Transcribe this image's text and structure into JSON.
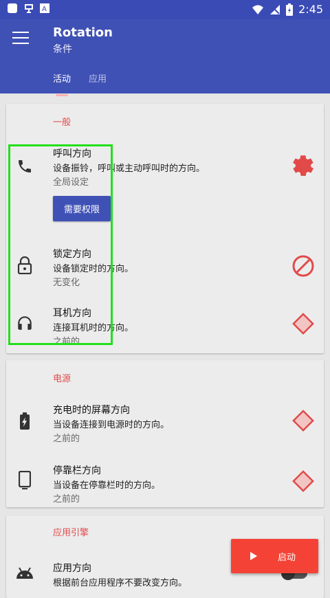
{
  "status_bar": {
    "time": "2:45",
    "icons": [
      "square-icon",
      "app-icon",
      "a-icon",
      "wifi-icon",
      "no-sim-icon",
      "battery-charging-icon"
    ]
  },
  "app": {
    "title": "Rotation",
    "subtitle": "条件",
    "tabs": [
      {
        "label": "活动",
        "active": true
      },
      {
        "label": "应用",
        "active": false
      }
    ]
  },
  "sections": [
    {
      "title": "一般",
      "items": [
        {
          "title": "呼叫方向",
          "desc": "设备振铃，呼叫或主动呼叫时的方向。",
          "value": "全局设定",
          "icon": "phone-icon",
          "action_icon": "settings-icon",
          "button": "需要权限"
        },
        {
          "title": "锁定方向",
          "desc": "设备锁定时的方向。",
          "value": "无变化",
          "icon": "lock-icon",
          "action_icon": "block-icon"
        },
        {
          "title": "耳机方向",
          "desc": "连接耳机时的方向。",
          "value": "之前的",
          "icon": "headphones-icon",
          "action_icon": "rotate-diamond-icon"
        }
      ]
    },
    {
      "title": "电源",
      "items": [
        {
          "title": "充电时的屏幕方向",
          "desc": "当设备连接到电源时的方向。",
          "value": "之前的",
          "icon": "battery-charging-icon",
          "action_icon": "rotate-diamond-icon"
        },
        {
          "title": "停靠栏方向",
          "desc": "当设备在停靠栏时的方向。",
          "value": "之前的",
          "icon": "dock-icon",
          "action_icon": "rotate-diamond-icon"
        }
      ]
    },
    {
      "title": "应用引擎",
      "items": [
        {
          "title": "应用方向",
          "desc": "根据前台应用程序不要改变方向。",
          "icon": "android-icon"
        }
      ]
    }
  ],
  "fab": {
    "label": "启动",
    "icon": "play-icon"
  },
  "colors": {
    "primary": "#3f51b5",
    "accent": "#f44336",
    "section_title": "#e24a4a",
    "highlight": "#22e01b"
  }
}
